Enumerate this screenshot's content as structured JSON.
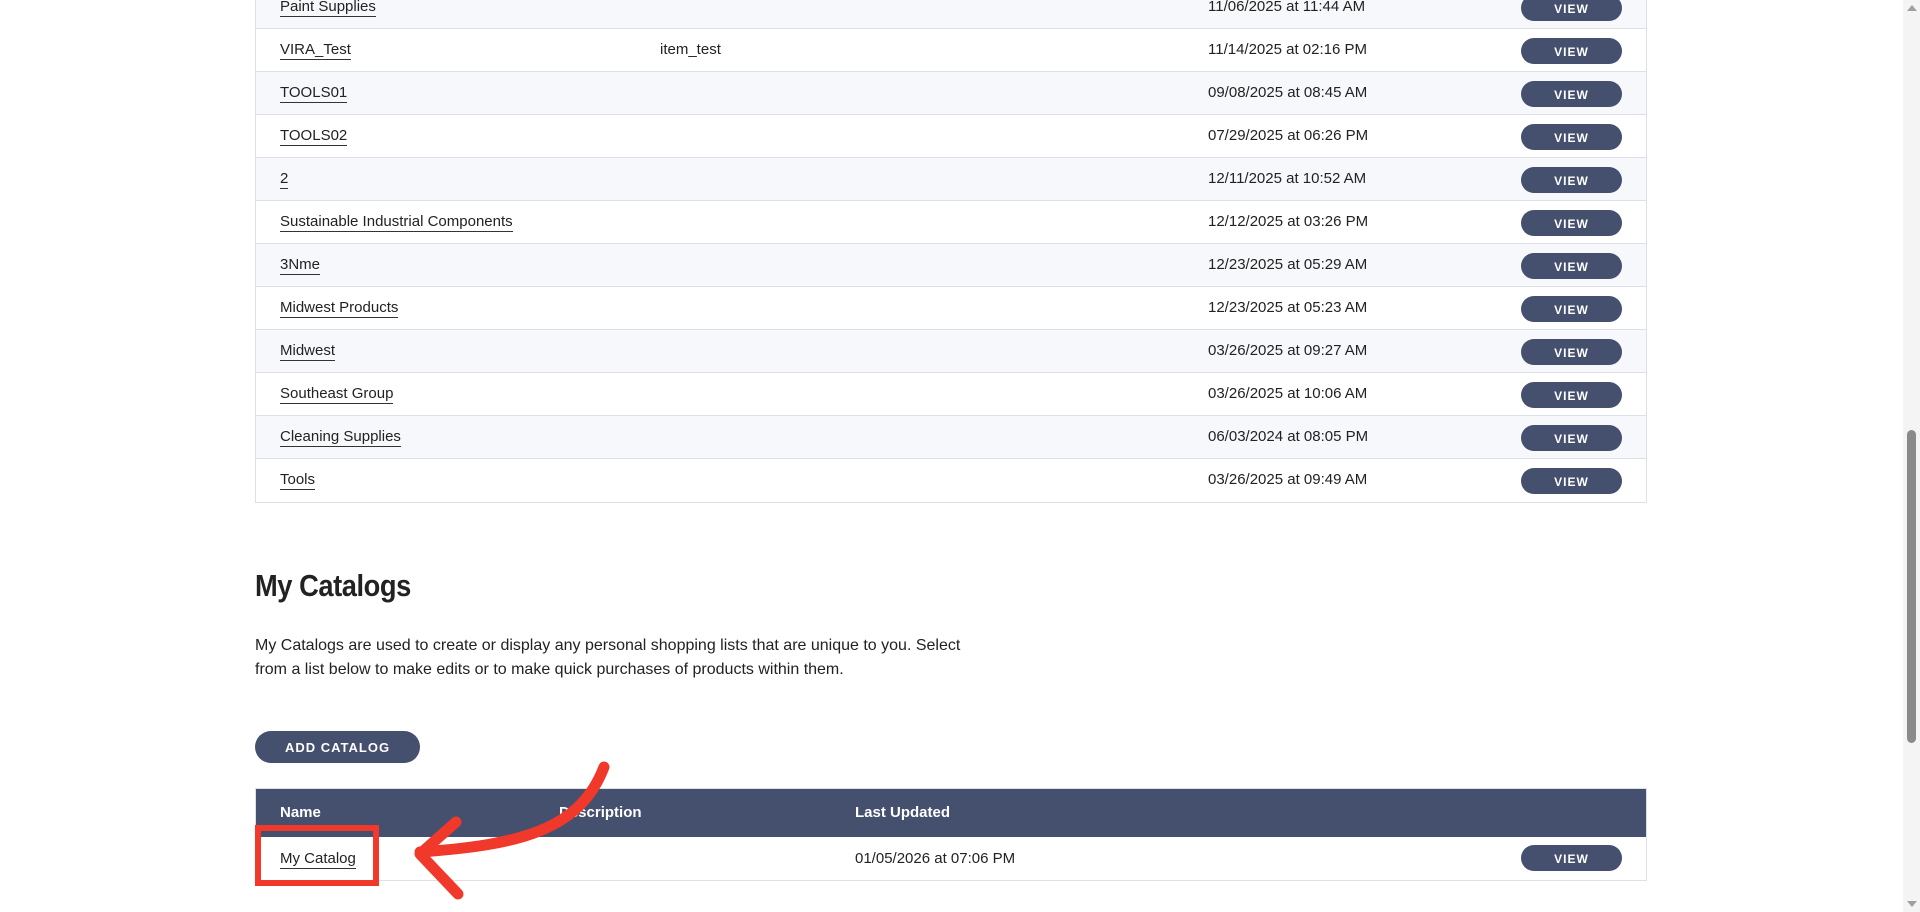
{
  "top_table": {
    "rows": [
      {
        "name": "Paint Supplies",
        "description": "",
        "date": "11/06/2025 at 11:44 AM",
        "action": "VIEW"
      },
      {
        "name": "VIRA_Test",
        "description": "item_test",
        "date": "11/14/2025 at 02:16 PM",
        "action": "VIEW"
      },
      {
        "name": "TOOLS01",
        "description": "",
        "date": "09/08/2025 at 08:45 AM",
        "action": "VIEW"
      },
      {
        "name": "TOOLS02",
        "description": "",
        "date": "07/29/2025 at 06:26 PM",
        "action": "VIEW"
      },
      {
        "name": "2",
        "description": "",
        "date": "12/11/2025 at 10:52 AM",
        "action": "VIEW"
      },
      {
        "name": "Sustainable Industrial Components",
        "description": "",
        "date": "12/12/2025 at 03:26 PM",
        "action": "VIEW"
      },
      {
        "name": "3Nme",
        "description": "",
        "date": "12/23/2025 at 05:29 AM",
        "action": "VIEW"
      },
      {
        "name": "Midwest Products",
        "description": "",
        "date": "12/23/2025 at 05:23 AM",
        "action": "VIEW"
      },
      {
        "name": "Midwest",
        "description": "",
        "date": "03/26/2025 at 09:27 AM",
        "action": "VIEW"
      },
      {
        "name": "Southeast Group",
        "description": "",
        "date": "03/26/2025 at 10:06 AM",
        "action": "VIEW"
      },
      {
        "name": "Cleaning Supplies",
        "description": "",
        "date": "06/03/2024 at 08:05 PM",
        "action": "VIEW"
      },
      {
        "name": "Tools",
        "description": "",
        "date": "03/26/2025 at 09:49 AM",
        "action": "VIEW"
      }
    ]
  },
  "my_catalogs": {
    "title": "My Catalogs",
    "description": "My Catalogs are used to create or display any personal shopping lists that are unique to you. Select from a list below to make edits or to make quick purchases of products within them.",
    "add_button": "ADD CATALOG",
    "headers": {
      "name": "Name",
      "description": "Description",
      "last_updated": "Last Updated"
    },
    "rows": [
      {
        "name": "My Catalog",
        "description": "",
        "date": "01/05/2026 at 07:06 PM",
        "action": "VIEW"
      }
    ]
  },
  "colors": {
    "accent": "#454f6e",
    "annotation": "#f0392b"
  }
}
